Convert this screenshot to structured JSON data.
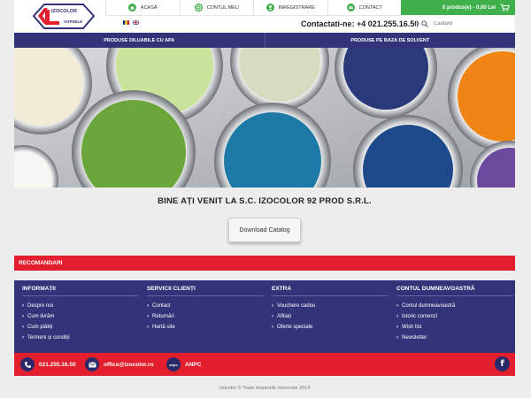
{
  "header": {
    "logo_text_top": "IZOCOLOR",
    "logo_text_bottom": "VOPSELE",
    "nav": [
      {
        "label": "Acasă",
        "icon": "home-icon"
      },
      {
        "label": "Contul meu",
        "icon": "user-circle-icon"
      },
      {
        "label": "Inregistrare",
        "icon": "person-icon"
      },
      {
        "label": "Contact",
        "icon": "mail-icon"
      }
    ],
    "cart_text": "0 produs(e) - 0,00 Lei",
    "contact_text": "Contactati-ne: +4 021.255.16.50",
    "search_placeholder": "Cautare",
    "colors": {
      "nav_bg": "#33337a",
      "cart_bg": "#3fb04a",
      "accent_red": "#e31e2d"
    }
  },
  "categories": [
    "Produse diluabile cu apa",
    "Produse pe baza de solvent"
  ],
  "main": {
    "welcome": "BINE AȚI VENIT LA S.C. IZOCOLOR 92 PROD S.R.L.",
    "download_label": "Download Catalog",
    "recommended": "RECOMANDARI"
  },
  "footer": {
    "columns": [
      {
        "title": "Informații",
        "items": [
          "Despre noi",
          "Cum livrăm",
          "Cum plătiți",
          "Termeni și condiții"
        ]
      },
      {
        "title": "Servicii clienți",
        "items": [
          "Contact",
          "Returnări",
          "Hartă site"
        ]
      },
      {
        "title": "Extra",
        "items": [
          "Vouchere cadou",
          "Afiliați",
          "Oferte speciale"
        ]
      },
      {
        "title": "Contul dumneavoastră",
        "items": [
          "Contul dumneavoastră",
          "Istoric comenzi",
          "Wish list",
          "Newsletter"
        ]
      }
    ],
    "phone": "021.255.16.50",
    "email": "office@izocolor.ro",
    "anpc_badge": "anpc",
    "anpc": "ANPC",
    "facebook_letter": "f",
    "copyright": "Izocolor © Toate drepturile rezervate 2014"
  }
}
